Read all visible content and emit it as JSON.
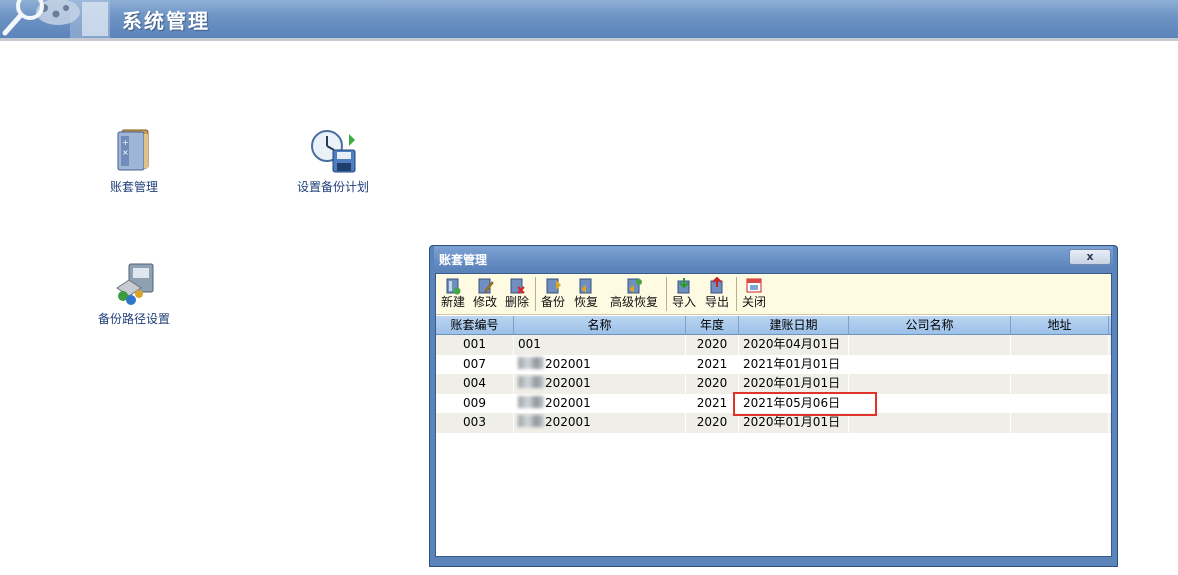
{
  "header": {
    "title": "系统管理"
  },
  "shortcuts": {
    "account_mgmt": "账套管理",
    "backup_plan": "设置备份计划",
    "backup_path": "备份路径设置"
  },
  "dialog": {
    "title": "账套管理",
    "close_label": "x",
    "toolbar": [
      {
        "label": "新建",
        "icon": "new-account-icon"
      },
      {
        "label": "修改",
        "icon": "edit-icon"
      },
      {
        "label": "删除",
        "icon": "delete-icon"
      },
      {
        "label": "备份",
        "icon": "backup-icon"
      },
      {
        "label": "恢复",
        "icon": "restore-icon"
      },
      {
        "label": "高级恢复",
        "icon": "advanced-restore-icon"
      },
      {
        "label": "导入",
        "icon": "import-icon"
      },
      {
        "label": "导出",
        "icon": "export-icon"
      },
      {
        "label": "关闭",
        "icon": "close-window-icon"
      }
    ],
    "columns": [
      "账套编号",
      "名称",
      "年度",
      "建账日期",
      "公司名称",
      "地址"
    ],
    "rows": [
      {
        "id": "001",
        "name": "001",
        "name_blurred": false,
        "year": "2020",
        "date": "2020年04月01日",
        "company": "",
        "address": ""
      },
      {
        "id": "007",
        "name": "202001",
        "name_blurred": true,
        "year": "2021",
        "date": "2021年01月01日",
        "company": "",
        "address": ""
      },
      {
        "id": "004",
        "name": "202001",
        "name_blurred": true,
        "year": "2020",
        "date": "2020年01月01日",
        "company": "",
        "address": ""
      },
      {
        "id": "009",
        "name": "202001",
        "name_blurred": true,
        "year": "2021",
        "date": "2021年05月06日",
        "company": "",
        "address": ""
      },
      {
        "id": "003",
        "name": "202001",
        "name_blurred": true,
        "year": "2020",
        "date": "2020年01月01日",
        "company": "",
        "address": ""
      }
    ]
  },
  "colors": {
    "header_blue": "#6d93c4",
    "toolbar_bg": "#fffbe3",
    "grid_header": "#9cc0e8",
    "highlight": "#e0332b"
  }
}
